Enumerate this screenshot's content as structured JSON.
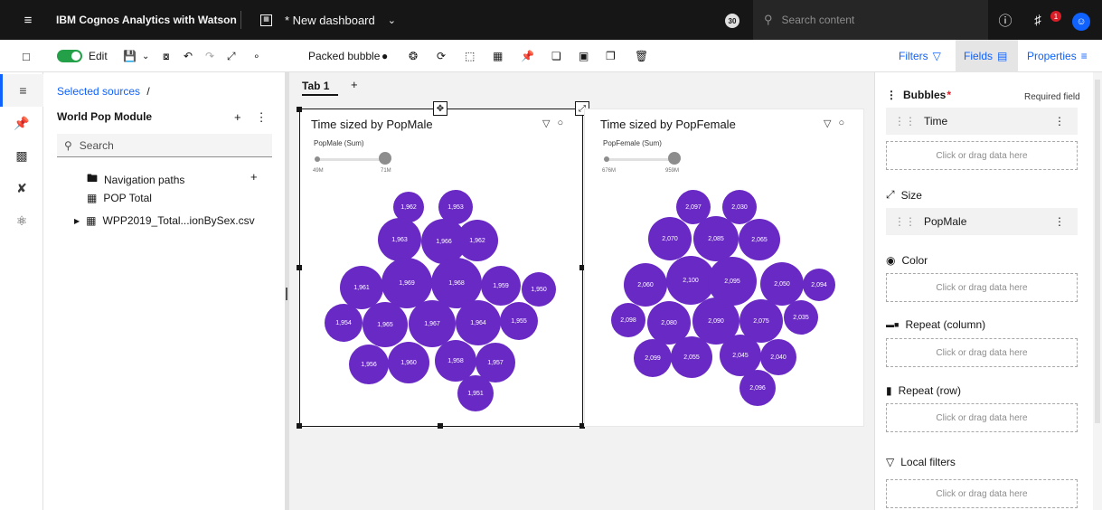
{
  "topbar": {
    "menu_icon": "hamburger-icon",
    "brand": "IBM Cognos Analytics with Watson",
    "dashboard_icon": "dashboard-icon",
    "dashboard_title": "* New dashboard",
    "counter_badge": "30",
    "search_placeholder": "Search content",
    "notification_count": "1"
  },
  "toolbar": {
    "edit_label": "Edit",
    "viz_type_label": "Packed bubble",
    "filters_label": "Filters",
    "fields_label": "Fields",
    "properties_label": "Properties"
  },
  "sources": {
    "selected_sources_link": "Selected sources",
    "breadcrumb_sep": "/",
    "module_title": "World Pop Module",
    "search_placeholder": "Search",
    "tree": [
      {
        "label": "Navigation paths",
        "icon": "folder-icon"
      },
      {
        "label": "POP Total",
        "icon": "table-icon"
      },
      {
        "label": "WPP2019_Total...ionBySex.csv",
        "icon": "table-icon"
      }
    ]
  },
  "canvas": {
    "tabs": [
      {
        "label": "Tab 1"
      }
    ],
    "add_tab": "+",
    "accent_color": "#6929c4"
  },
  "widgets": [
    {
      "title": "Time sized by PopMale",
      "legend_title": "PopMale (Sum)",
      "range_min": "49M",
      "range_max": "71M",
      "bubble_labels": [
        "1,962",
        "1,953",
        "1,963",
        "1,966",
        "1,962",
        "1,961",
        "1,969",
        "1,968",
        "1,959",
        "1,950",
        "1,954",
        "1,965",
        "1,967",
        "1,964",
        "1,955",
        "1,956",
        "1,960",
        "1,958",
        "1,957",
        "1,951"
      ]
    },
    {
      "title": "Time sized by PopFemale",
      "legend_title": "PopFemale (Sum)",
      "range_min": "676M",
      "range_max": "959M",
      "bubble_labels": [
        "2,097",
        "2,030",
        "2,070",
        "2,085",
        "2,065",
        "2,060",
        "2,100",
        "2,095",
        "2,050",
        "2,094",
        "2,098",
        "2,080",
        "2,090",
        "2,075",
        "2,035",
        "2,099",
        "2,055",
        "2,045",
        "2,040",
        "2,096"
      ]
    }
  ],
  "properties": {
    "bubbles_label": "Bubbles",
    "required_mark": "*",
    "required_text": "Required field",
    "bubbles_field": "Time",
    "size_label": "Size",
    "size_field": "PopMale",
    "color_label": "Color",
    "repeat_col_label": "Repeat (column)",
    "repeat_row_label": "Repeat (row)",
    "local_filters_label": "Local filters",
    "drop_text": "Click or drag data here"
  }
}
